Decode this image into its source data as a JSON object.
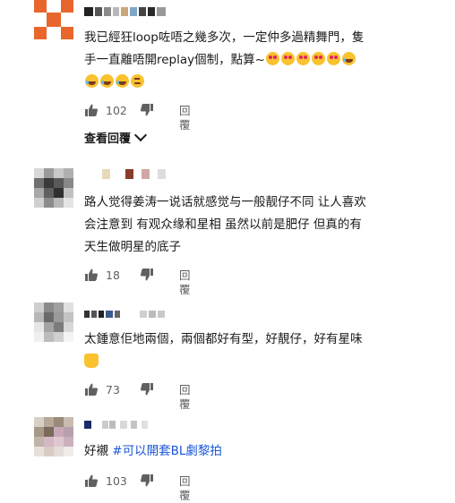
{
  "comments": [
    {
      "text_line1": "我已經狂loop咗唔之幾多次，一定仲多過精舞門，隻",
      "text_line2": "手一直離唔開replay個制，點算~",
      "likes": "102",
      "reply_label": "回覆",
      "view_replies_label": "查看回覆",
      "avatar_colors": [
        "#e8662c",
        "#ffffff"
      ]
    },
    {
      "text_line1": "路人觉得姜涛一说话就感觉与一般靓仔不同 让人喜欢",
      "text_line2": "会注意到 有观众缘和星相 虽然以前是肥仔 但真的有",
      "text_line3": "天生做明星的底子",
      "likes": "18",
      "reply_label": "回覆"
    },
    {
      "text_line1": "太鍾意佢地兩個，兩個都好有型，好靚仔，好有星味",
      "likes": "73",
      "reply_label": "回覆"
    },
    {
      "text_plain": "好襯 ",
      "text_hashtag": "#可以開套BL劇黎拍",
      "likes": "103",
      "reply_label": "回覆"
    }
  ],
  "colors": {
    "hashtag": "#1a56d6",
    "meta_text": "#606060",
    "accent_avatar": "#e8662c"
  }
}
